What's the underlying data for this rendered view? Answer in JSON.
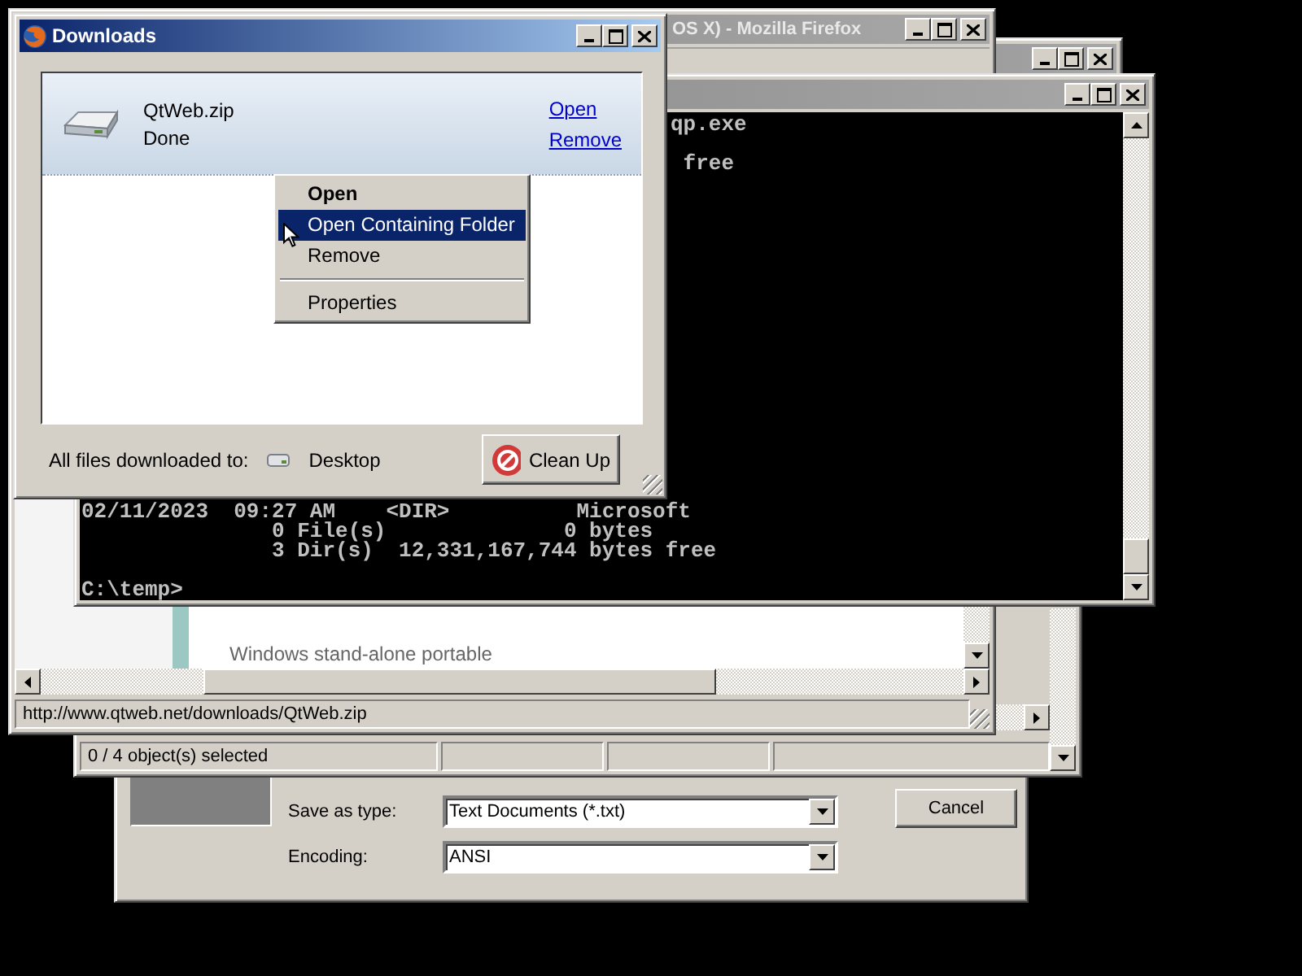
{
  "save_dialog": {
    "fields": [
      {
        "label": "Save as type:",
        "value": "Text Documents (*.txt)"
      },
      {
        "label": "Encoding:",
        "value": "ANSI"
      }
    ],
    "buttons": [
      "Cancel"
    ]
  },
  "explorer_window": {
    "status_text": "0 / 4 object(s) selected"
  },
  "back_window": {
    "active": false
  },
  "browser_window": {
    "active": false,
    "title": "OS X) - Mozilla Firefox",
    "content_text": "Windows stand-alone portable",
    "status_text": "http://www.qtweb.net/downloads/QtWeb.zip"
  },
  "console_window": {
    "active": false,
    "top_lines": [
      {
        "kind": "fragment",
        "text": "qp.exe"
      },
      {
        "kind": "blank"
      },
      {
        "kind": "fragment",
        "text": " free"
      }
    ],
    "bottom_lines": [
      {
        "kind": "line",
        "text": "02/11/2023  09:27 AM    <DIR>          Microsoft"
      },
      {
        "kind": "line",
        "text": "               0 File(s)              0 bytes"
      },
      {
        "kind": "line",
        "text": "               3 Dir(s)  12,331,167,744 bytes free"
      },
      {
        "kind": "blank"
      },
      {
        "kind": "line",
        "text": "C:\\temp>"
      }
    ]
  },
  "downloads_window": {
    "active": true,
    "title": "Downloads",
    "items": [
      {
        "name": "QtWeb.zip",
        "status": "Done",
        "actions": [
          "Open",
          "Remove"
        ]
      }
    ],
    "footer_label": "All files downloaded to:",
    "folder": "Desktop",
    "button": "Clean Up"
  },
  "context_menu": {
    "items": [
      {
        "kind": "item",
        "label": "Open",
        "default": true,
        "selected": false
      },
      {
        "kind": "item",
        "label": "Open Containing Folder",
        "default": false,
        "selected": true
      },
      {
        "kind": "item",
        "label": "Remove",
        "default": false,
        "selected": false
      },
      {
        "kind": "separator"
      },
      {
        "kind": "item",
        "label": "Properties",
        "default": false,
        "selected": false
      }
    ]
  }
}
